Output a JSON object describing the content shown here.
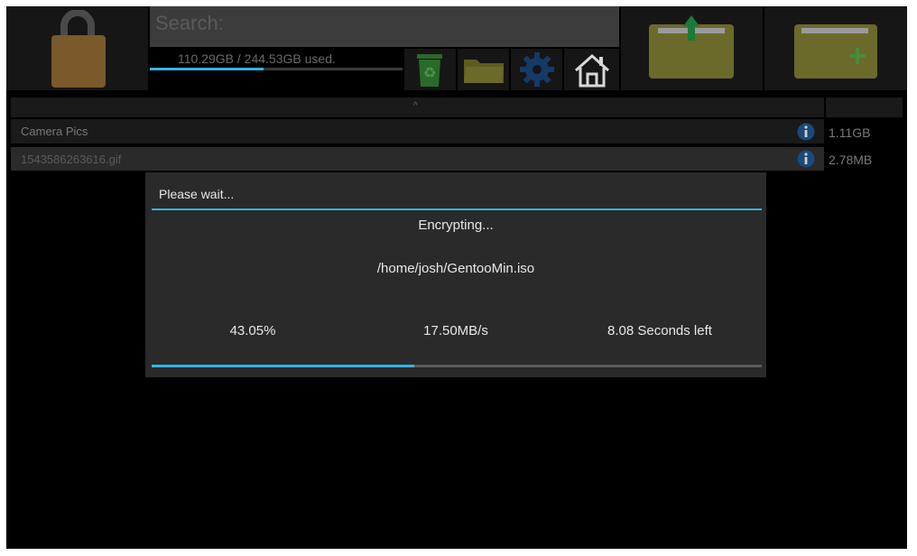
{
  "header": {
    "search_placeholder": "Search:",
    "storage_text": "110.29GB / 244.53GB used.",
    "storage_fraction": 0.451
  },
  "toolbar": {
    "lock_icon": "lock-icon",
    "recycle_icon": "recycle-bin-icon",
    "folder_icon": "folder-icon",
    "settings_icon": "gear-icon",
    "home_icon": "home-icon",
    "export_icon": "folder-export-icon",
    "new_folder_icon": "folder-add-icon"
  },
  "list": {
    "sort_indicator": "^",
    "rows": [
      {
        "name": "Camera Pics",
        "size": "1.11GB"
      },
      {
        "name": "1543586263616.gif",
        "size": "2.78MB"
      }
    ]
  },
  "dialog": {
    "title": "Please wait...",
    "status": "Encrypting...",
    "path": "/home/josh/GentooMin.iso",
    "percent": "43.05%",
    "speed": "17.50MB/s",
    "time_left": "8.08 Seconds left",
    "progress": 0.4305
  },
  "colors": {
    "accent": "#33b5e5",
    "folder": "#6b6a2a",
    "lock": "#7a5a2a",
    "tile": "#161616"
  }
}
